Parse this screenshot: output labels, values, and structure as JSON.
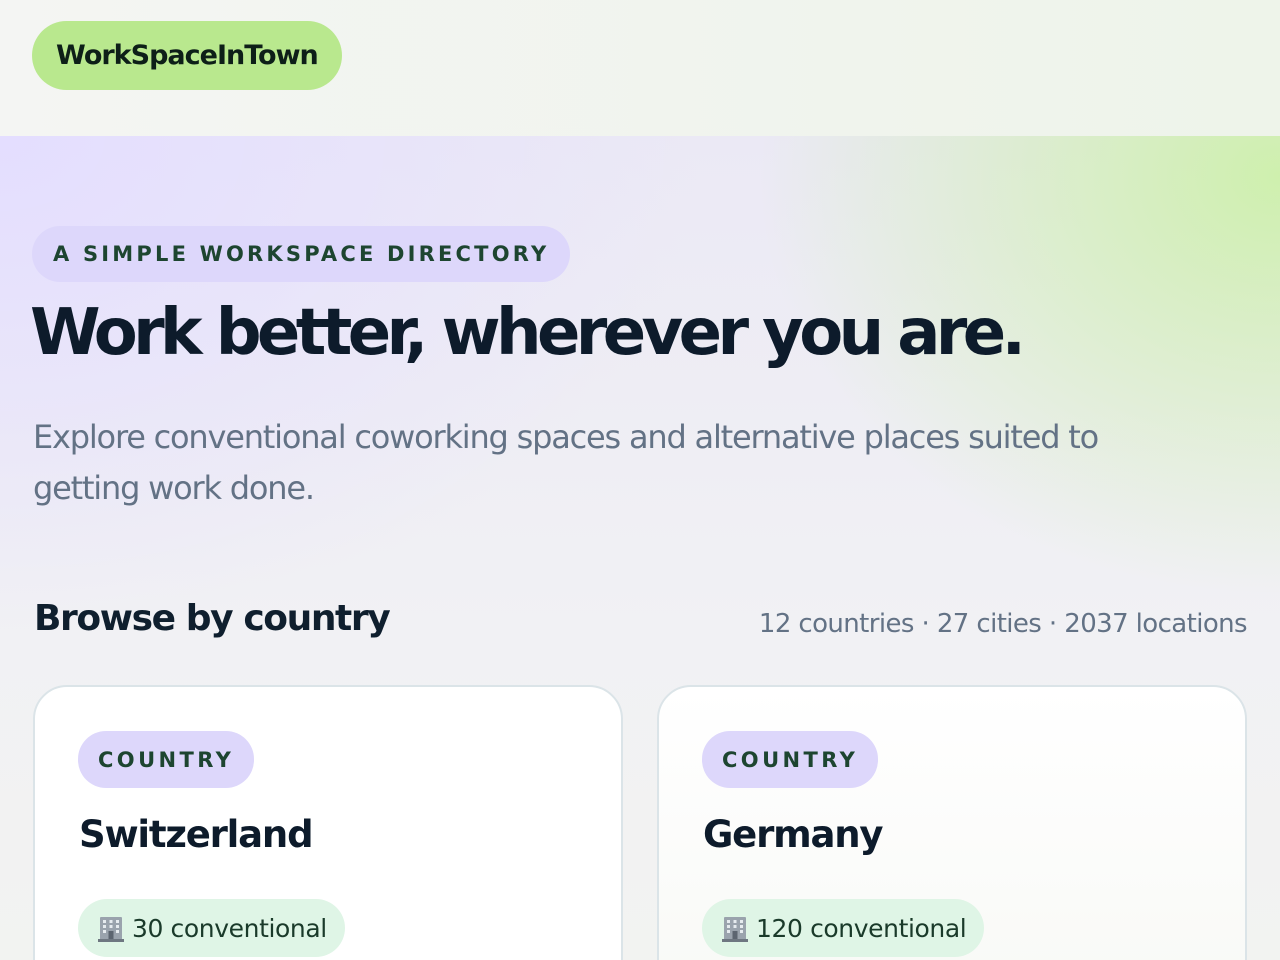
{
  "header": {
    "brand": "WorkSpaceInTown"
  },
  "hero": {
    "eyebrow": "A SIMPLE WORKSPACE DIRECTORY",
    "title": "Work better, wherever you are.",
    "subtitle": "Explore conventional coworking spaces and alternative places suited to getting work done."
  },
  "browse": {
    "title": "Browse by country",
    "stats": "12 countries · 27 cities · 2037 locations",
    "countries": [
      {
        "tag": "COUNTRY",
        "name": "Switzerland",
        "chip_icon": "building-icon",
        "chip": "30 conventional"
      },
      {
        "tag": "COUNTRY",
        "name": "Germany",
        "chip_icon": "building-icon",
        "chip": "120 conventional"
      }
    ]
  },
  "colors": {
    "brand_green": "#b9e88e",
    "lavender_pill": "#ddd7fb",
    "mint_chip": "#dff5e6",
    "heading": "#0d1b2b",
    "muted": "#637285"
  }
}
